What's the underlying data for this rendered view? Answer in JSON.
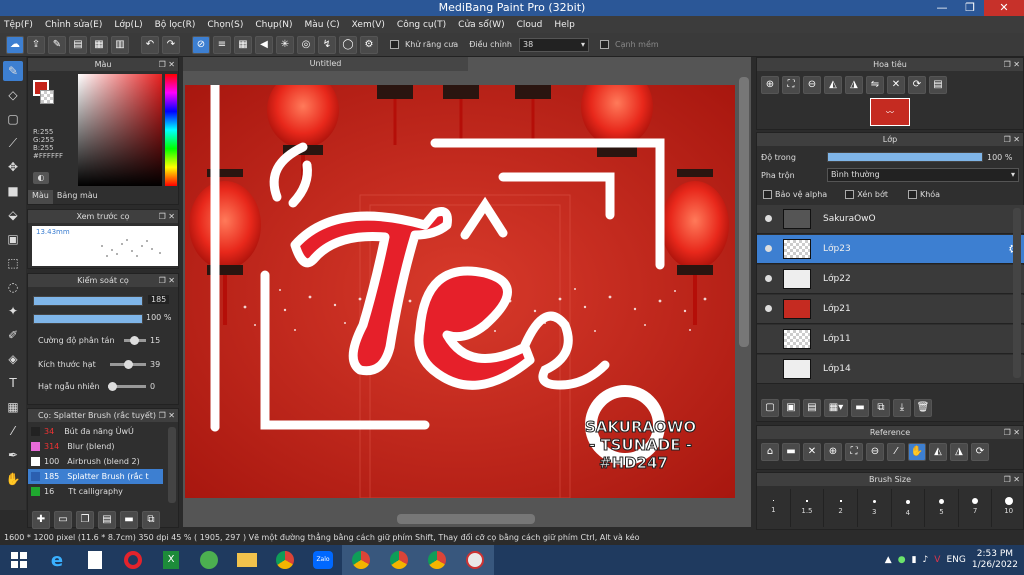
{
  "window": {
    "title": "MediBang Paint Pro (32bit)",
    "min": "—",
    "max": "❐",
    "close": "✕"
  },
  "menu": [
    "Tệp(F)",
    "Chỉnh sửa(E)",
    "Lớp(L)",
    "Bộ lọc(R)",
    "Chọn(S)",
    "Chụp(N)",
    "Màu (C)",
    "Xem(V)",
    "Công cụ(T)",
    "Cửa sổ(W)",
    "Cloud",
    "Help"
  ],
  "toolbar": {
    "antialias_label": "Khử răng cưa",
    "adjust_label": "Điều chỉnh",
    "adjust_value": "38",
    "snap_label": "Cạnh mềm"
  },
  "color_panel": {
    "title": "Màu",
    "r": "R:255",
    "g": "G:255",
    "b": "B:255",
    "hex": "#FFFFFF",
    "tab_color": "Màu",
    "tab_palette": "Bảng màu"
  },
  "brush_preview": {
    "title": "Xem trước cọ",
    "size": "13.43mm"
  },
  "brush_control": {
    "title": "Kiểm soát cọ",
    "size": "185",
    "opacity": "100 %",
    "scatter_label": "Cường độ phân tán",
    "scatter": "15",
    "particle_label": "Kích thước hạt",
    "particle": "39",
    "random_label": "Hạt ngẫu nhiên",
    "random": "0"
  },
  "brush_list": {
    "title": "Cọ: Splatter Brush (rắc tuyết)",
    "items": [
      {
        "num": "34",
        "name": "Bút đa năng ÙwÚ",
        "color": "#222222"
      },
      {
        "num": "314",
        "name": "Blur (blend)",
        "color": "#e86bd8"
      },
      {
        "num": "100",
        "name": "Airbrush (blend 2)",
        "color": "#ffffff"
      },
      {
        "num": "185",
        "name": "Splatter Brush (rắc t",
        "color": "#3d7fd1"
      },
      {
        "num": "16",
        "name": "Tt calligraphy",
        "color": "#1fa82f"
      }
    ]
  },
  "document": {
    "tab": "Untitled"
  },
  "artwork": {
    "watermark": [
      "SAKURAOWO",
      "- TSUNADE -",
      "#HD247"
    ]
  },
  "navigator": {
    "title": "Hoa tiêu"
  },
  "layers_panel": {
    "title": "Lớp",
    "opacity_label": "Độ trong",
    "opacity": "100 %",
    "blend_label": "Pha trộn",
    "blend": "Bình thường",
    "protect_alpha": "Bảo vệ alpha",
    "clip": "Xén bớt",
    "lock": "Khóa",
    "layers": [
      {
        "name": "SakuraOwO",
        "visible": true,
        "selected": false
      },
      {
        "name": "Lớp23",
        "visible": true,
        "selected": true
      },
      {
        "name": "Lớp22",
        "visible": true,
        "selected": false
      },
      {
        "name": "Lớp21",
        "visible": true,
        "selected": false
      },
      {
        "name": "Lớp11",
        "visible": false,
        "selected": false
      },
      {
        "name": "Lớp14",
        "visible": false,
        "selected": false
      }
    ]
  },
  "reference": {
    "title": "Reference"
  },
  "brush_size": {
    "title": "Brush Size",
    "sizes": [
      "1",
      "1.5",
      "2",
      "3",
      "4",
      "5",
      "7",
      "10"
    ]
  },
  "status": {
    "text": "1600 * 1200 pixel  (11.6 * 8.7cm)  350 dpi  45 %  ( 1905, 297 )  Vẽ một đường thẳng bằng cách giữ phím Shift, Thay đổi cỡ cọ bằng cách giữ phím Ctrl, Alt và kéo"
  },
  "taskbar": {
    "lang": "ENG",
    "time": "2:53 PM",
    "date": "1/26/2022"
  }
}
